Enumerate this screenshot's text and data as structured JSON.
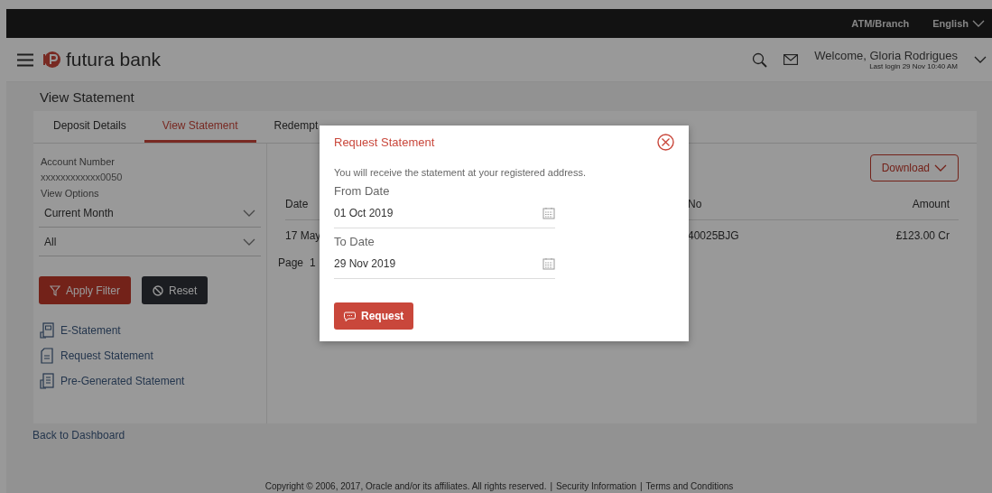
{
  "top_bar": {
    "links": [
      "ATM/Branch",
      "English"
    ]
  },
  "header": {
    "logo": "futura bank",
    "welcome": "Welcome, Gloria Rodrigues",
    "last_login": "Last login 29 Nov 10:40 AM"
  },
  "page_title": "View Statement",
  "tabs": [
    {
      "label": "Deposit Details",
      "selected": false
    },
    {
      "label": "View Statement",
      "selected": true
    },
    {
      "label": "Redempt",
      "selected": false
    }
  ],
  "filters": {
    "account_label": "Account Number",
    "account_number": "xxxxxxxxxxxx0050",
    "view_options_label": "View Options",
    "selects": [
      "Current Month",
      "All"
    ],
    "buttons": [
      {
        "label": "Apply Filter",
        "kind": "primary"
      },
      {
        "label": "Reset",
        "kind": "secondary"
      }
    ],
    "links": [
      {
        "label": "E-Statement",
        "kind": "e-statement"
      },
      {
        "label": "Request Statement",
        "kind": "request"
      },
      {
        "label": "Pre-Generated Statement",
        "kind": "pre-generated"
      }
    ]
  },
  "table": {
    "download": "Download",
    "columns": [
      "Date",
      "No",
      "Amount"
    ],
    "rows": [
      [
        "17 May",
        "40025BJG",
        "£123.00 Cr"
      ]
    ],
    "page_label": "Page",
    "page": "1"
  },
  "back_link": "Back to Dashboard",
  "footer": {
    "copyright": "Copyright © 2006, 2017, Oracle and/or its affiliates. All rights reserved.",
    "separator": "|",
    "links": [
      "Security Information",
      "Terms and Conditions"
    ]
  },
  "modal": {
    "title": "Request Statement",
    "message": "You will receive the statement at your registered address.",
    "fields": [
      {
        "label": "From Date",
        "value": "01 Oct 2019"
      },
      {
        "label": "To Date",
        "value": "29 Nov 2019"
      }
    ],
    "button": "Request"
  }
}
